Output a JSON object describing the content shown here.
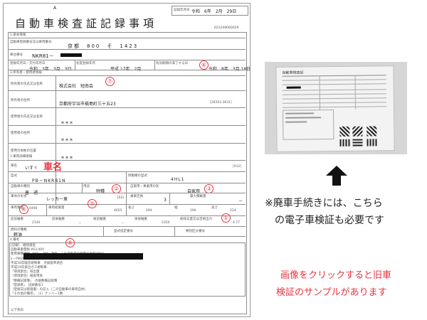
{
  "document": {
    "header_a": "A",
    "title": "自動車検査証記録事項",
    "record_date_label": "記録年月日",
    "record_date": "令和　6年　2月　29日",
    "doc_number": "621249060029",
    "sec1_label": "1.基本情報",
    "reg_no_label": "自動車登録番号又は車両番号",
    "reg_no_value": "京都　800　そ　1423",
    "chassis_label": "車台番号",
    "chassis_value": "NKR81－",
    "first_reg_label": "登録年月日／交付年月日",
    "first_reg_value": "令和　3年　3月　3日",
    "initial_reg_label": "初度登録年月",
    "initial_reg_value": "平成 17年　2月",
    "expiry_label": "有効期間の満了する日",
    "expiry_value": "令和　8年　3月 18日",
    "sec2_label": "2.所有者・使用者情報",
    "owner_name_label": "所有者の氏名又は名称",
    "owner_name_value": "株式会社　短南会",
    "owner_addr_label": "所有者の住所",
    "owner_addr_value": "京都府宇治市槇島町三十五23",
    "owner_code": "[26503 3631]",
    "user_name_label": "使用者の氏名又は名称",
    "user_name_value": "＊＊＊",
    "user_addr_label": "使用者の住所",
    "user_addr_value": "＊＊＊",
    "base_label": "使用の本拠の位置",
    "base_value": "＊＊＊",
    "sec3_label": "3.車両詳細情報",
    "maker_label": "車名",
    "maker_value": "いすゞ",
    "maker_annotation": "車名",
    "maker_code": "[012]",
    "model_label": "型式",
    "model_value": "PB－NKR81N",
    "engine_label": "原動機の型式",
    "engine_value": "4HL1",
    "kind_label": "自動車の種別",
    "kind_value": "普　通",
    "use_label": "用途",
    "use_value": "特種",
    "purpose_label": "自家用・事業用の別",
    "purpose_value": "自家用",
    "shape_label": "車体の形状",
    "shape_value": "レッカー車",
    "shape_code": "[62]",
    "capacity_label": "乗車定員",
    "capacity_value": "3",
    "load_label": "最大積載量",
    "load_value": "－",
    "weight_label": "車両重量",
    "weight_value": "4490",
    "gross_label": "車両総重量",
    "gross_value": "4655",
    "length_label": "長さ",
    "length_value": "494",
    "width_label": "幅",
    "width_value": "190",
    "height_label": "高さ",
    "height_value": "224",
    "front_axle_label": "前前軸重",
    "front_axle_value": "2140",
    "front_rear_label": "前後軸重",
    "front_rear_value": "－",
    "rear_front_label": "後前軸重",
    "rear_front_value": "－",
    "rear_rear_label": "後後軸重",
    "rear_rear_value": "2350",
    "displacement_label": "総排気量又は定格出力",
    "displacement_value": "4.77",
    "fuel_label": "燃料の種類",
    "fuel_value": "軽油",
    "model_desig_label": "型式指定番号",
    "model_desig_value": "",
    "category_label": "類別区分番号",
    "category_value": "",
    "sec4_label": "4.備考",
    "remarks": [
      "[記載]　継続検査",
      "自動車重量税 ¥63,000",
      "使用車種規制（NOx・PM）適合。この自動車の使用の本拠がNO",
      "x・PM対策地域内で",
      "",
      "",
      "平成18年騒音規制車　点検基準適合",
      "平成19年排出ガス規制車",
      "「環境割合」排出量",
      "（環境割合）検査用具",
      "「整備記録簿」　点検整備記録簿",
      "「登録者」　記録番号1",
      "（登録又は管理書）の記入（この自動車の車両自体）",
      "「その他の備考」　（1）ナンバー1数",
      "以下余白"
    ],
    "circle_numbers": [
      "①",
      "②",
      "③",
      "④",
      "⑤",
      "⑥",
      "⑦",
      "⑧"
    ]
  },
  "right": {
    "thumb_title": "自動車検査証",
    "note_line1": "※廃車手続きには、こちら",
    "note_line2": "の電子車検証も必要です",
    "cta_line1": "画像をクリックすると旧車",
    "cta_line2": "検証のサンプルがあります",
    "colors": {
      "annotation_red": "#e8353f",
      "arrow": "#111111"
    },
    "arrow_icon": "up-arrow-icon"
  }
}
